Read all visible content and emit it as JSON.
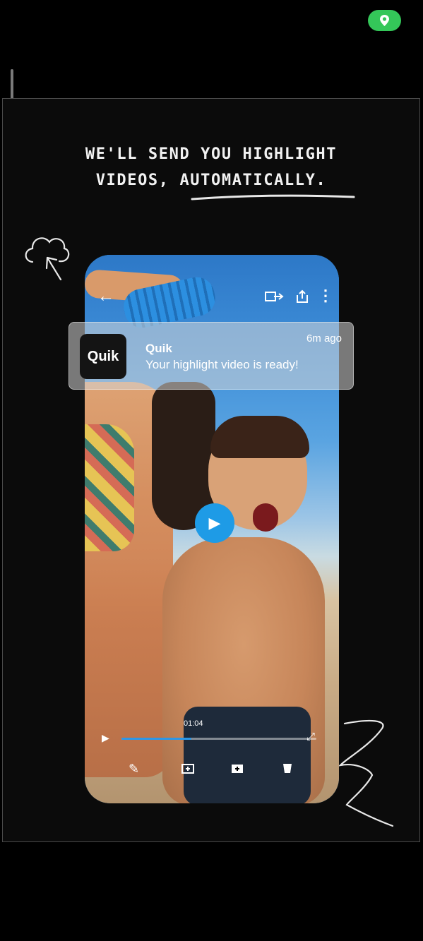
{
  "headline": {
    "line1": "WE'LL SEND YOU HIGHLIGHT",
    "line2": "VIDEOS, AUTOMATICALLY."
  },
  "notification": {
    "app_icon_text": "Quik",
    "app_name": "Quik",
    "message": "Your highlight video is ready!",
    "time": "6m ago"
  },
  "player": {
    "timestamp": "01:04",
    "progress": 0.36
  },
  "icons": {
    "location": "location-pin-icon",
    "back": "back-arrow-icon",
    "cast": "cast-to-device-icon",
    "share": "share-icon",
    "more": "more-vertical-icon",
    "play": "play-icon",
    "edit": "edit-pencil-icon",
    "add_media": "add-media-icon",
    "add_clip": "add-clip-icon",
    "mug": "mug-icon"
  },
  "colors": {
    "accent": "#1e9be6",
    "status_green": "#34c759"
  }
}
